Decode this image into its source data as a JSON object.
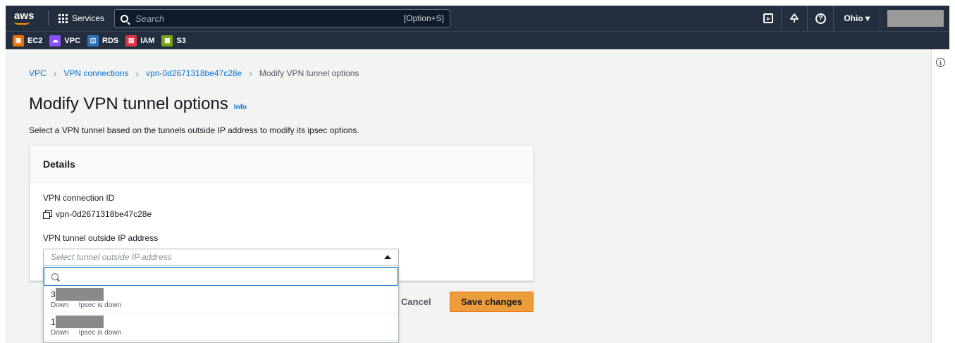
{
  "nav": {
    "logo": "aws",
    "services": "Services",
    "search_placeholder": "Search",
    "search_shortcut": "[Option+S]",
    "cloudshell": "▹",
    "help": "?",
    "region": "Ohio ▾",
    "favorites": [
      {
        "label": "EC2",
        "color": "#ed7100"
      },
      {
        "label": "VPC",
        "color": "#8c4fff"
      },
      {
        "label": "RDS",
        "color": "#2e73b8"
      },
      {
        "label": "IAM",
        "color": "#dd344c"
      },
      {
        "label": "S3",
        "color": "#7aa116"
      }
    ]
  },
  "breadcrumb": {
    "items": [
      "VPC",
      "VPN connections",
      "vpn-0d2671318be47c28e"
    ],
    "current": "Modify VPN tunnel options"
  },
  "page": {
    "title": "Modify VPN tunnel options",
    "info": "Info",
    "description": "Select a VPN tunnel based on the tunnels outside IP address to modify its ipsec options."
  },
  "details": {
    "header": "Details",
    "connection_id_label": "VPN connection ID",
    "connection_id": "vpn-0d2671318be47c28e",
    "tunnel_ip_label": "VPN tunnel outside IP address",
    "select_placeholder": "Select tunnel outside IP address",
    "options": [
      {
        "prefix": "3",
        "status": "Down",
        "detail": "Ipsec is down"
      },
      {
        "prefix": "1",
        "status": "Down",
        "detail": "Ipsec is down"
      }
    ]
  },
  "actions": {
    "cancel": "Cancel",
    "save": "Save changes"
  },
  "rail": {
    "info": "i"
  }
}
